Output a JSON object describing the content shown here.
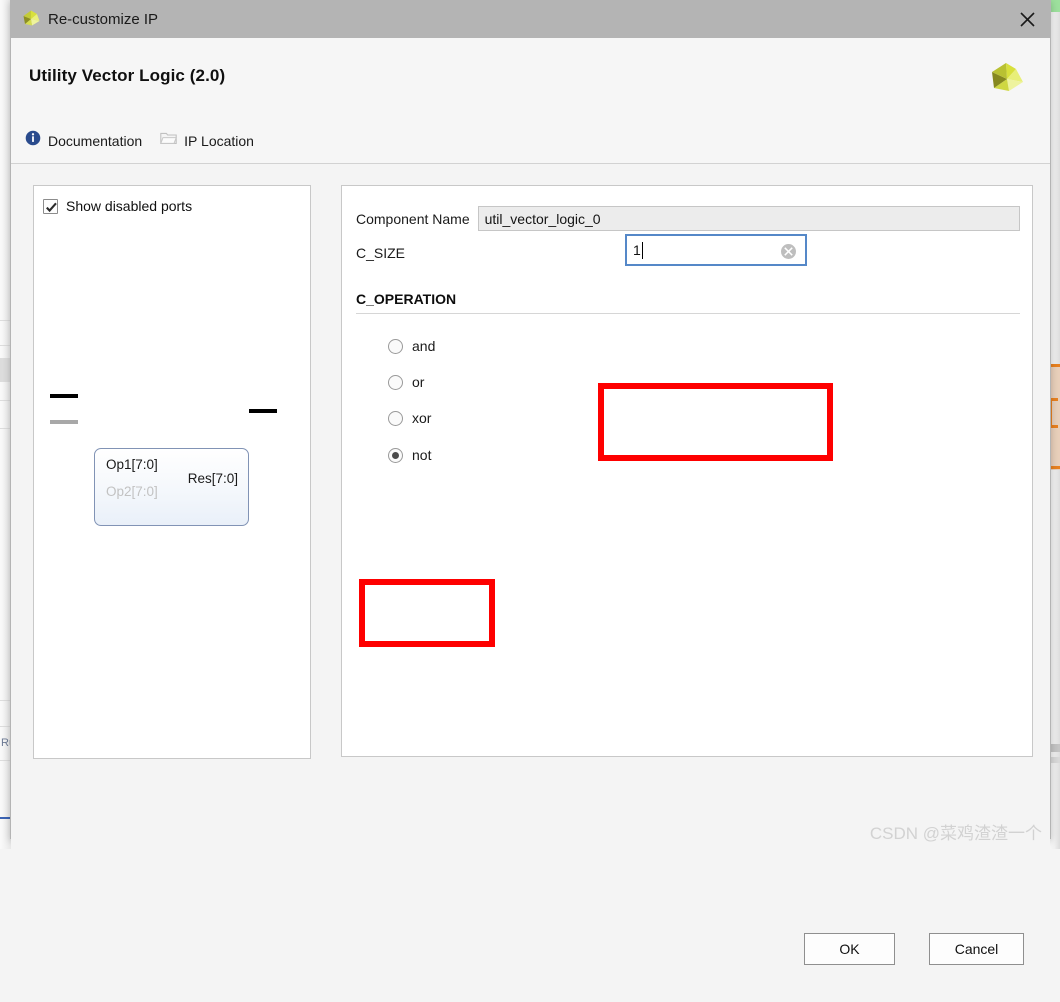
{
  "window": {
    "title": "Re-customize IP",
    "app_icon": "xilinx-logo-icon",
    "close_icon": "close-icon"
  },
  "header": {
    "ip_title": "Utility Vector Logic (2.0)",
    "vendor_logo": "xilinx-logo-icon",
    "links": [
      {
        "label": "Documentation",
        "icon": "info-icon"
      },
      {
        "label": "IP Location",
        "icon": "folder-icon"
      }
    ]
  },
  "left_panel": {
    "show_disabled_ports": {
      "label": "Show disabled ports",
      "checked": true
    },
    "symbol": {
      "inputs": [
        {
          "label": "Op1[7:0]",
          "enabled": true
        },
        {
          "label": "Op2[7:0]",
          "enabled": false
        }
      ],
      "outputs": [
        {
          "label": "Res[7:0]",
          "enabled": true
        }
      ]
    }
  },
  "right_panel": {
    "component_name": {
      "label": "Component Name",
      "value": "util_vector_logic_0"
    },
    "c_size": {
      "label": "C_SIZE",
      "value": "1",
      "placeholder": "",
      "clear_icon": "clear-circle-icon"
    },
    "c_operation": {
      "label": "C_OPERATION",
      "selected": "not",
      "options": [
        {
          "label": "and",
          "checked": false
        },
        {
          "label": "or",
          "checked": false
        },
        {
          "label": "xor",
          "checked": false
        },
        {
          "label": "not",
          "checked": true
        }
      ]
    }
  },
  "footer": {
    "ok_label": "OK",
    "cancel_label": "Cancel"
  },
  "watermark": "CSDN @菜鸡渣渣一个",
  "colors": {
    "annotation": "#FE0000",
    "titlebar": "#B4B4B4",
    "focus_border": "#5588C8",
    "vendor_logo": "#C8D83C"
  }
}
